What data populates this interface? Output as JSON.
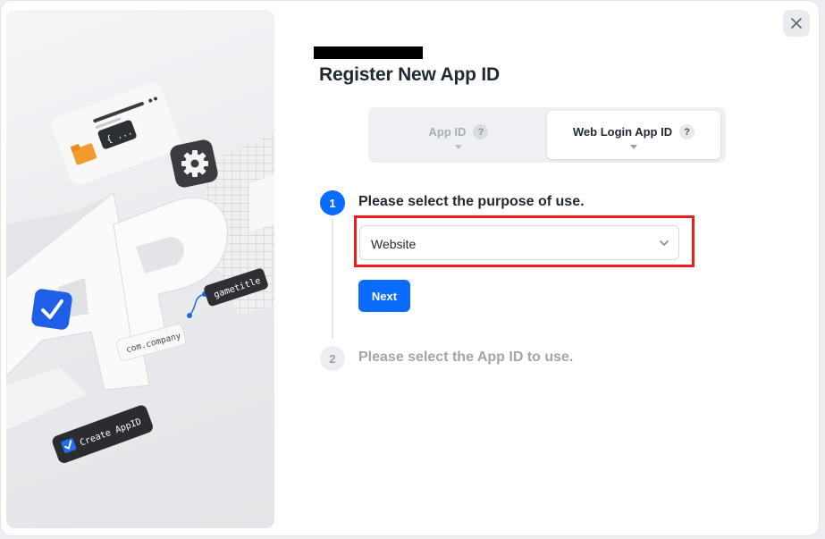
{
  "dialog": {
    "title": "Register New App ID",
    "close_icon": "close-icon"
  },
  "illustration": {
    "app_letters": "AP",
    "tag_gametitle": "gametitle",
    "tag_company": "com.company",
    "badge_label": "Create AppID",
    "code_snippet": "{ ... }"
  },
  "tabs": [
    {
      "label": "App ID",
      "help": "?",
      "selected": false
    },
    {
      "label": "Web Login App ID",
      "help": "?",
      "selected": true
    }
  ],
  "steps": [
    {
      "number": "1",
      "title": "Please select the purpose of use.",
      "select_value": "Website",
      "button_label": "Next"
    },
    {
      "number": "2",
      "title": "Please select the App ID to use."
    }
  ],
  "colors": {
    "primary": "#0a6cff",
    "highlight": "#ee1c1c"
  }
}
